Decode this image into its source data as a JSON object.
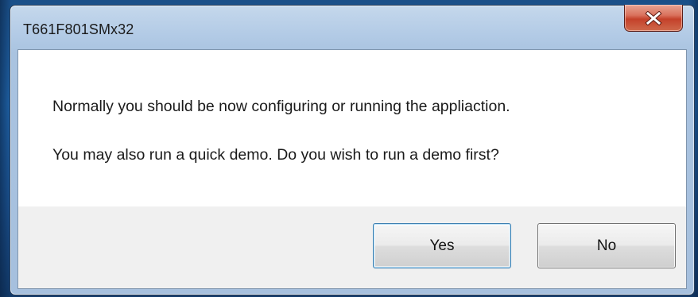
{
  "window": {
    "title": "T661F801SMx32",
    "close_label": "Close"
  },
  "message": {
    "line1": "Normally you should be now configuring or running the appliaction.",
    "line2": "You may also run a quick demo. Do you wish to run a demo first?"
  },
  "buttons": {
    "yes": "Yes",
    "no": "No"
  },
  "icons": {
    "close": "close-x-icon"
  },
  "colors": {
    "desktop": "#1f63a8",
    "close_button": "#c4412a",
    "default_button_border": "#3c7fb1"
  }
}
